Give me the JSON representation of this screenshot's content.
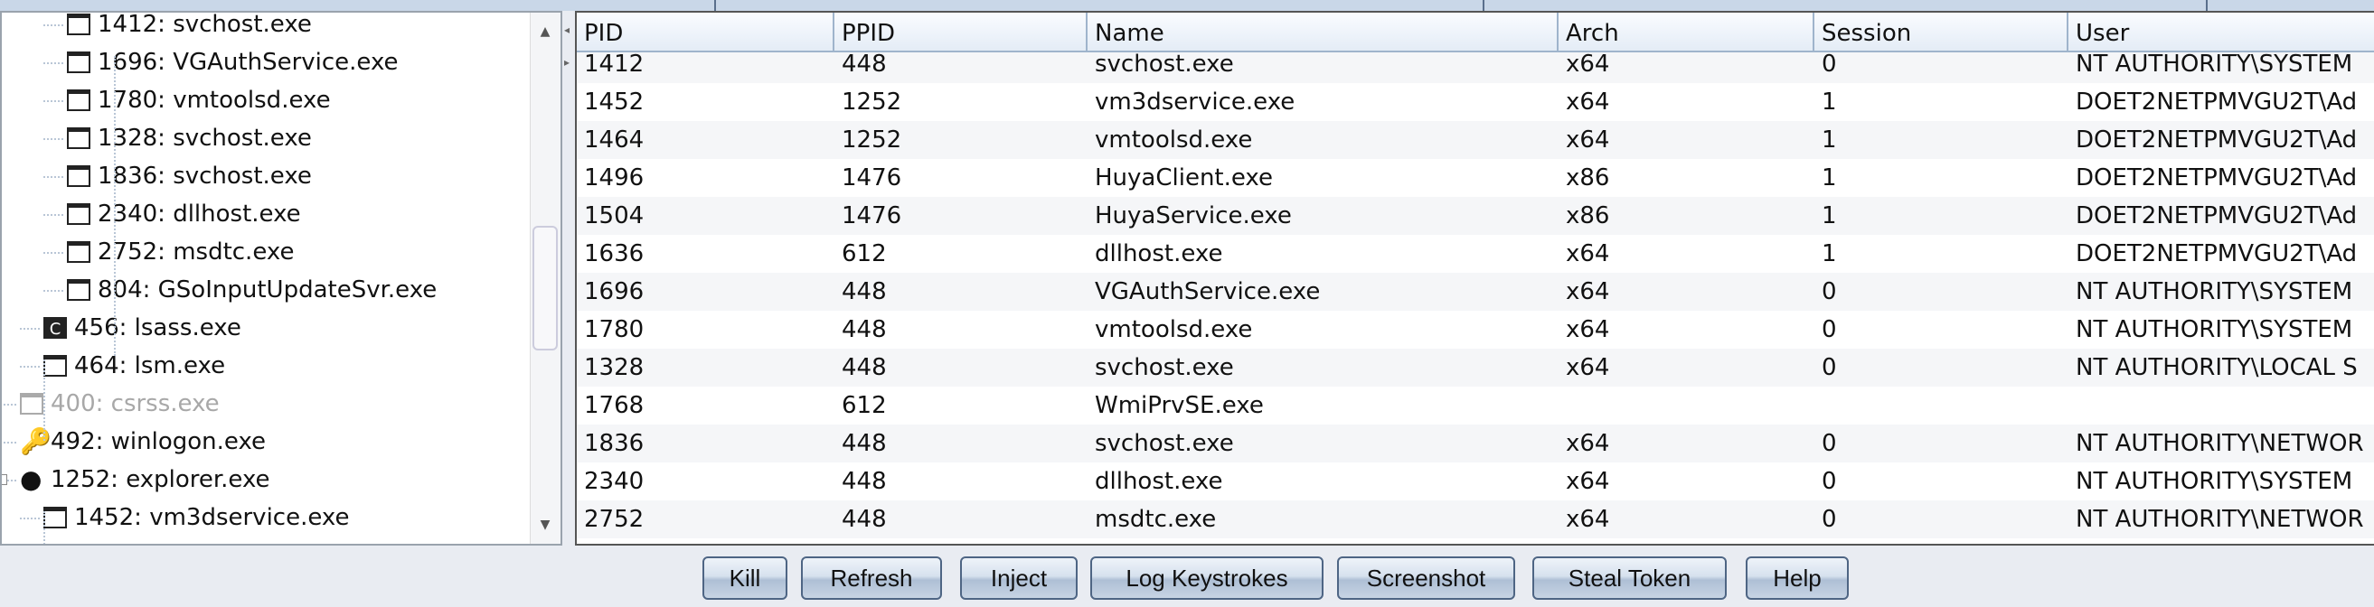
{
  "tree": {
    "items": [
      {
        "label": "1412: svchost.exe",
        "level": 3,
        "icon": "window-icon"
      },
      {
        "label": "1696: VGAuthService.exe",
        "level": 3,
        "icon": "window-icon"
      },
      {
        "label": "1780: vmtoolsd.exe",
        "level": 3,
        "icon": "window-icon"
      },
      {
        "label": "1328: svchost.exe",
        "level": 3,
        "icon": "window-icon"
      },
      {
        "label": "1836: svchost.exe",
        "level": 3,
        "icon": "window-icon"
      },
      {
        "label": "2340: dllhost.exe",
        "level": 3,
        "icon": "window-icon"
      },
      {
        "label": "2752: msdtc.exe",
        "level": 3,
        "icon": "window-icon"
      },
      {
        "label": "804: GSoInputUpdateSvr.exe",
        "level": 3,
        "icon": "window-icon"
      },
      {
        "label": "456: lsass.exe",
        "level": 2,
        "icon": "lsass-icon"
      },
      {
        "label": "464: lsm.exe",
        "level": 2,
        "icon": "window-icon"
      },
      {
        "label": "400: csrss.exe",
        "level": 1,
        "icon": "window-icon",
        "dim": true
      },
      {
        "label": "492: winlogon.exe",
        "level": 1,
        "icon": "key-icon"
      },
      {
        "label": "1252: explorer.exe",
        "level": 1,
        "icon": "globe-icon",
        "expanded": true
      },
      {
        "label": "1452: vm3dservice.exe",
        "level": 2,
        "icon": "window-icon"
      },
      {
        "label": "1464: vmtoolsd.exe",
        "level": 2,
        "icon": "window-icon"
      }
    ]
  },
  "table": {
    "columns": [
      "PID",
      "PPID",
      "Name",
      "Arch",
      "Session",
      "User"
    ],
    "rows": [
      [
        "1412",
        "448",
        "svchost.exe",
        "x64",
        "0",
        "NT AUTHORITY\\SYSTEM"
      ],
      [
        "1452",
        "1252",
        "vm3dservice.exe",
        "x64",
        "1",
        "DOET2NETPMVGU2T\\Ad"
      ],
      [
        "1464",
        "1252",
        "vmtoolsd.exe",
        "x64",
        "1",
        "DOET2NETPMVGU2T\\Ad"
      ],
      [
        "1496",
        "1476",
        "HuyaClient.exe",
        "x86",
        "1",
        "DOET2NETPMVGU2T\\Ad"
      ],
      [
        "1504",
        "1476",
        "HuyaService.exe",
        "x86",
        "1",
        "DOET2NETPMVGU2T\\Ad"
      ],
      [
        "1636",
        "612",
        "dllhost.exe",
        "x64",
        "1",
        "DOET2NETPMVGU2T\\Ad"
      ],
      [
        "1696",
        "448",
        "VGAuthService.exe",
        "x64",
        "0",
        "NT AUTHORITY\\SYSTEM"
      ],
      [
        "1780",
        "448",
        "vmtoolsd.exe",
        "x64",
        "0",
        "NT AUTHORITY\\SYSTEM"
      ],
      [
        "1328",
        "448",
        "svchost.exe",
        "x64",
        "0",
        "NT AUTHORITY\\LOCAL S"
      ],
      [
        "1768",
        "612",
        "WmiPrvSE.exe",
        "",
        "",
        ""
      ],
      [
        "1836",
        "448",
        "svchost.exe",
        "x64",
        "0",
        "NT AUTHORITY\\NETWOR"
      ],
      [
        "2340",
        "448",
        "dllhost.exe",
        "x64",
        "0",
        "NT AUTHORITY\\SYSTEM"
      ],
      [
        "2752",
        "448",
        "msdtc.exe",
        "x64",
        "0",
        "NT AUTHORITY\\NETWOR"
      ]
    ]
  },
  "buttons": [
    "Kill",
    "Refresh",
    "Inject",
    "Log Keystrokes",
    "Screenshot",
    "Steal Token",
    "Help"
  ]
}
